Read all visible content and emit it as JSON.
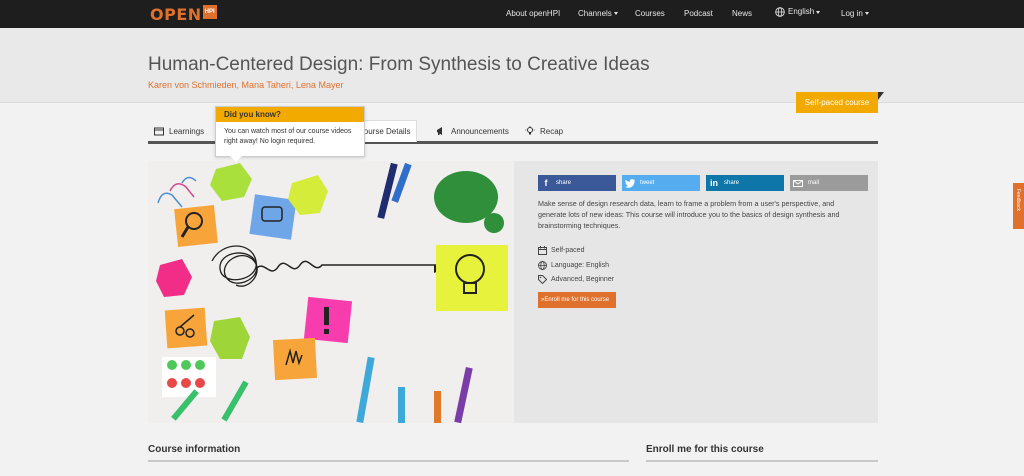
{
  "nav": {
    "logo_text": "OPEN",
    "logo_box": "HPI",
    "items": [
      "About openHPI",
      "Channels",
      "Courses",
      "Podcast",
      "News"
    ],
    "language": "English",
    "login": "Log in"
  },
  "course": {
    "title": "Human-Centered Design: From Synthesis to Creative Ideas",
    "authors": "Karen von Schmieden, Mana Taheri, Lena Mayer",
    "badge": "Self-paced course"
  },
  "tabs": [
    "Learnings",
    "Course Details",
    "Announcements",
    "Recap"
  ],
  "tooltip": {
    "title": "Did you know?",
    "body": "You can watch most of our course videos right away! No login required."
  },
  "share": {
    "facebook": "share",
    "twitter": "tweet",
    "linkedin": "share",
    "mail": "mail"
  },
  "description": "Make sense of design research data, learn to frame a problem from a user's perspective, and generate lots of new ideas: This course will introduce you to the basics of design synthesis and brainstorming techniques.",
  "meta": {
    "pace": "Self-paced",
    "language": "Language: English",
    "level": "Advanced, Beginner"
  },
  "enroll_label": "Enroll me for this course",
  "sections": {
    "course_info": "Course information",
    "enroll": "Enroll me for this course"
  },
  "feedback_tab": "Feedback",
  "colors": {
    "accent": "#e0712c",
    "badge": "#f2a900",
    "facebook": "#3b5998",
    "twitter": "#55acee",
    "linkedin": "#0e76a8"
  }
}
